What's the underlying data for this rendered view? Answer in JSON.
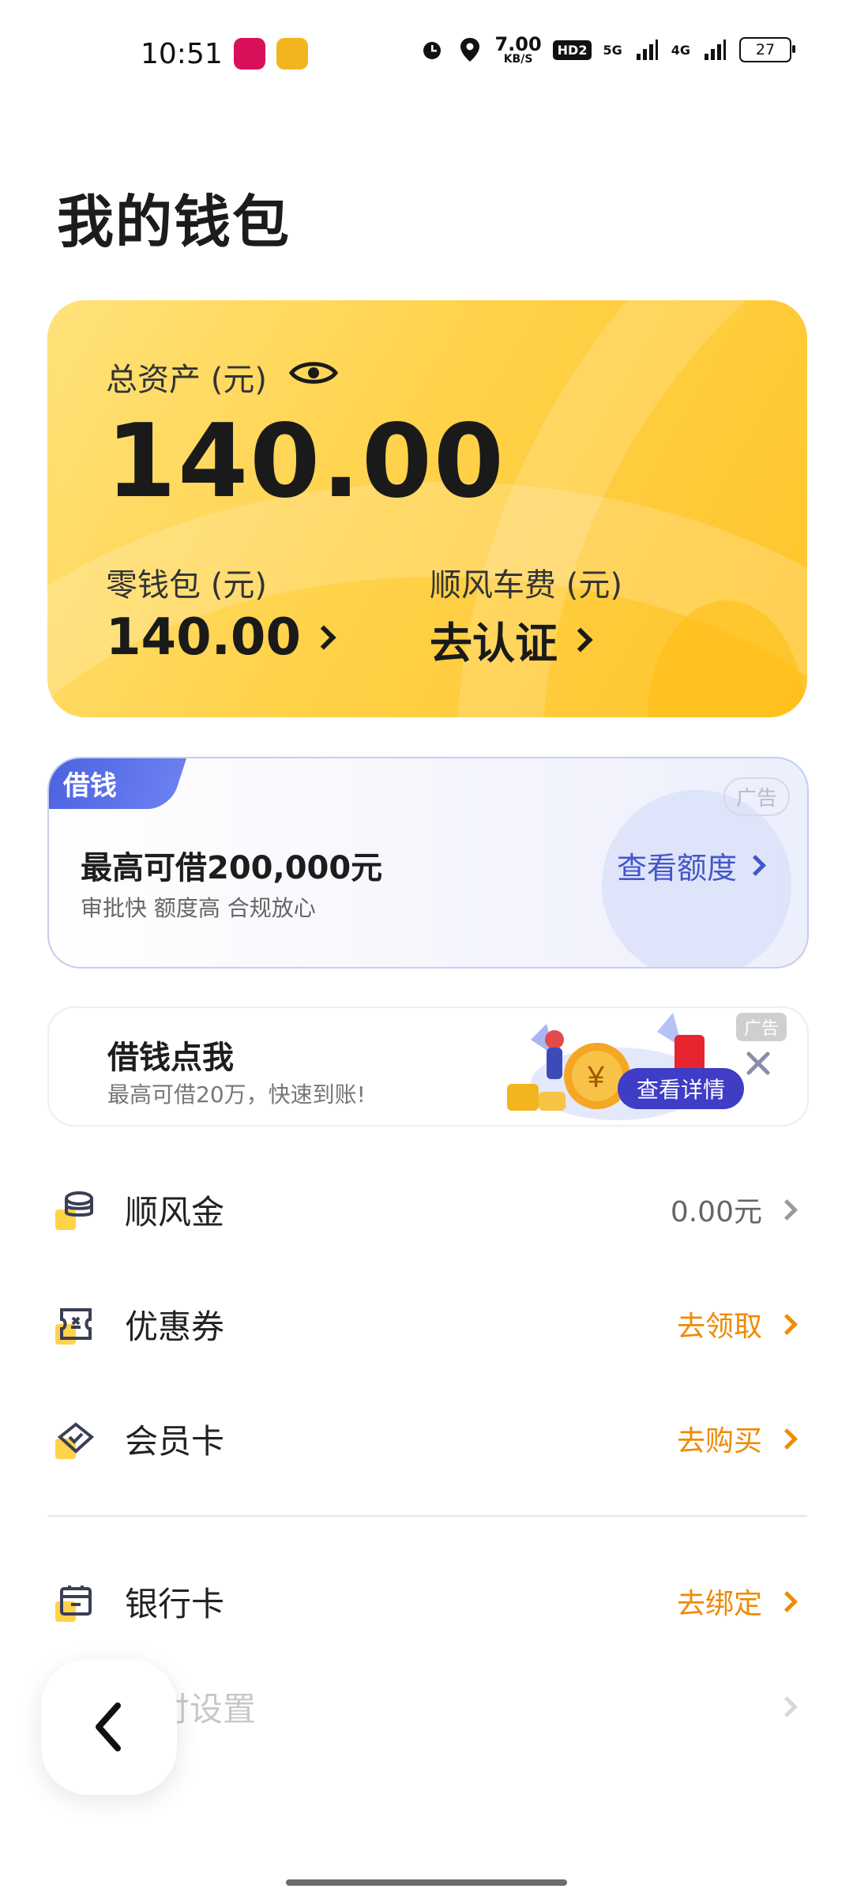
{
  "status_bar": {
    "time": "10:51",
    "speed_value": "7.00",
    "speed_unit": "KB/S",
    "hd_label": "HD2",
    "signal_1": "5G",
    "signal_2": "4G",
    "battery": "27"
  },
  "page": {
    "title": "我的钱包"
  },
  "assets": {
    "total_label": "总资产 (元)",
    "total_value": "140.00",
    "wallet_label": "零钱包 (元)",
    "wallet_value": "140.00",
    "ride_label": "顺风车费 (元)",
    "ride_value": "去认证"
  },
  "loan_card": {
    "tag": "借钱",
    "ad_label": "广告",
    "headline": "最高可借200,000元",
    "subline": "审批快 额度高 合规放心",
    "link": "查看额度"
  },
  "ad_banner": {
    "title": "借钱点我",
    "desc": "最高可借20万，快速到账!",
    "cta": "查看详情",
    "ad_label": "广告"
  },
  "list": [
    {
      "label": "顺风金",
      "value": "0.00元",
      "style": "gray",
      "icon": "coins-icon"
    },
    {
      "label": "优惠券",
      "value": "去领取",
      "style": "orange",
      "icon": "coupon-icon"
    },
    {
      "label": "会员卡",
      "value": "去购买",
      "style": "orange",
      "icon": "member-card-icon"
    },
    {
      "label": "银行卡",
      "value": "去绑定",
      "style": "orange",
      "icon": "bank-card-icon"
    },
    {
      "label": "付设置",
      "value": "",
      "style": "faded",
      "icon": "settings-icon"
    }
  ],
  "colors": {
    "accent_yellow": "#ffd24a",
    "link_blue": "#4556c8",
    "action_orange": "#f08a00"
  }
}
